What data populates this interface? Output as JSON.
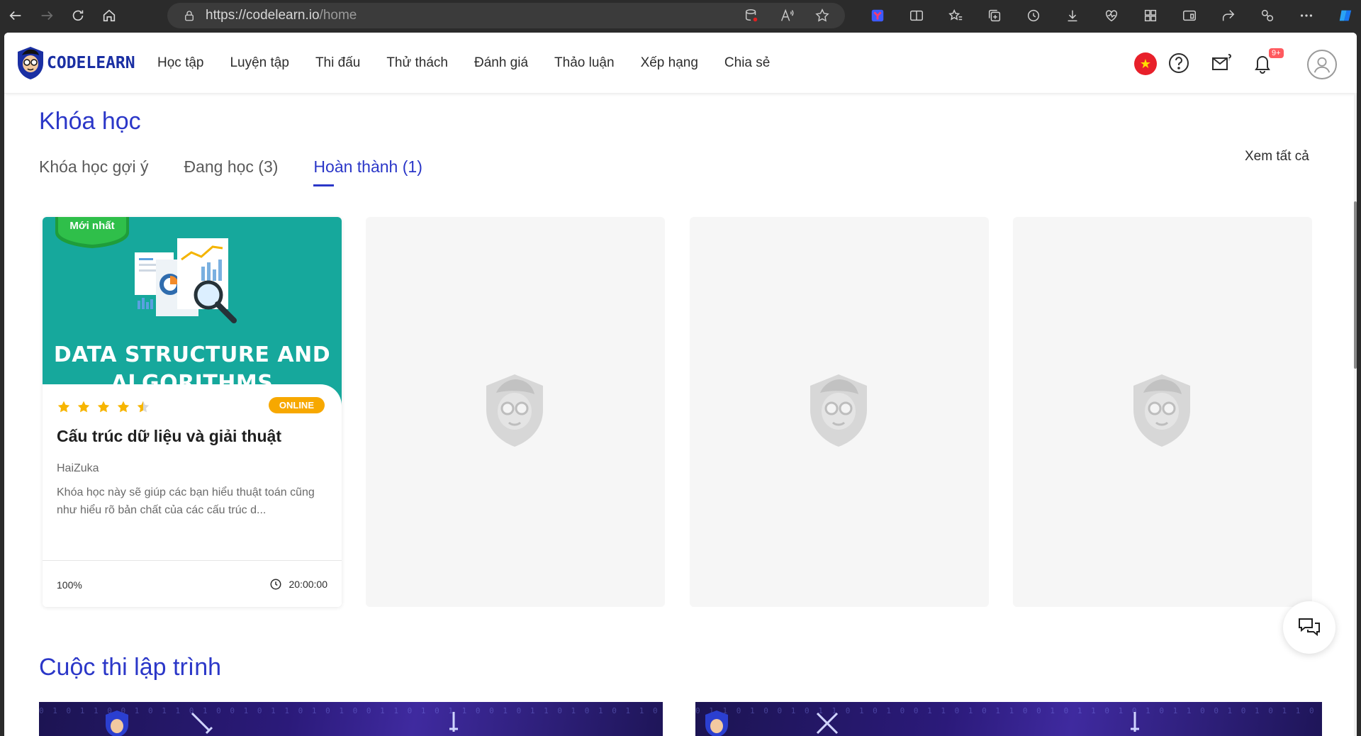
{
  "browser": {
    "url_host": "https://codelearn.io",
    "url_path": "/home"
  },
  "header": {
    "logo_text": "CODELEARN",
    "nav": [
      "Học tập",
      "Luyện tập",
      "Thi đấu",
      "Thử thách",
      "Đánh giá",
      "Thảo luận",
      "Xếp hạng",
      "Chia sẻ"
    ],
    "notification_badge": "9+"
  },
  "courses": {
    "title": "Khóa học",
    "tabs": [
      "Khóa học gợi ý",
      "Đang học (3)",
      "Hoàn thành (1)"
    ],
    "active_tab": 2,
    "see_all": "Xem tất cả",
    "card": {
      "ribbon": "Mới nhất",
      "thumb_title_1": "DATA STRUCTURE AND",
      "thumb_title_2": "ALGORITHMS",
      "rating": 4.5,
      "badge": "ONLINE",
      "title": "Cấu trúc dữ liệu và giải thuật",
      "author": "HaiZuka",
      "description": "Khóa học này sẽ giúp các bạn hiểu thuật toán cũng như hiểu rõ bản chất của các cấu trúc d...",
      "progress": "100%",
      "duration": "20:00:00"
    }
  },
  "contests": {
    "title": "Cuộc thi lập trình"
  },
  "colors": {
    "brand": "#2b37c8",
    "thumb_bg": "#16a89c",
    "badge": "#f7a800"
  }
}
